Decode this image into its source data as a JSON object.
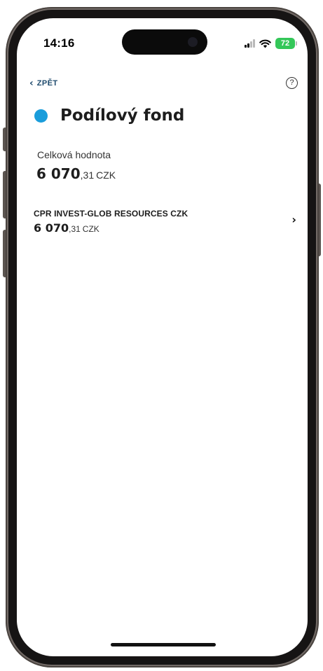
{
  "status_bar": {
    "time": "14:16",
    "battery": "72"
  },
  "nav": {
    "back_label": "ZPĚT",
    "help_symbol": "?"
  },
  "header": {
    "title": "Podílový fond",
    "dot_color": "#1a9ddb"
  },
  "summary": {
    "label": "Celková hodnota",
    "amount_int": "6 070",
    "amount_dec": ",31",
    "currency": "CZK"
  },
  "funds": [
    {
      "name": "CPR INVEST-GLOB RESOURCES CZK",
      "amount_int": "6 070",
      "amount_dec": ",31",
      "currency": "CZK"
    }
  ],
  "icons": {
    "back": "chevron-left-icon",
    "help": "question-circle-icon",
    "row": "chevron-right-icon",
    "signal": "cellular-signal-icon",
    "wifi": "wifi-icon",
    "battery": "battery-icon"
  }
}
